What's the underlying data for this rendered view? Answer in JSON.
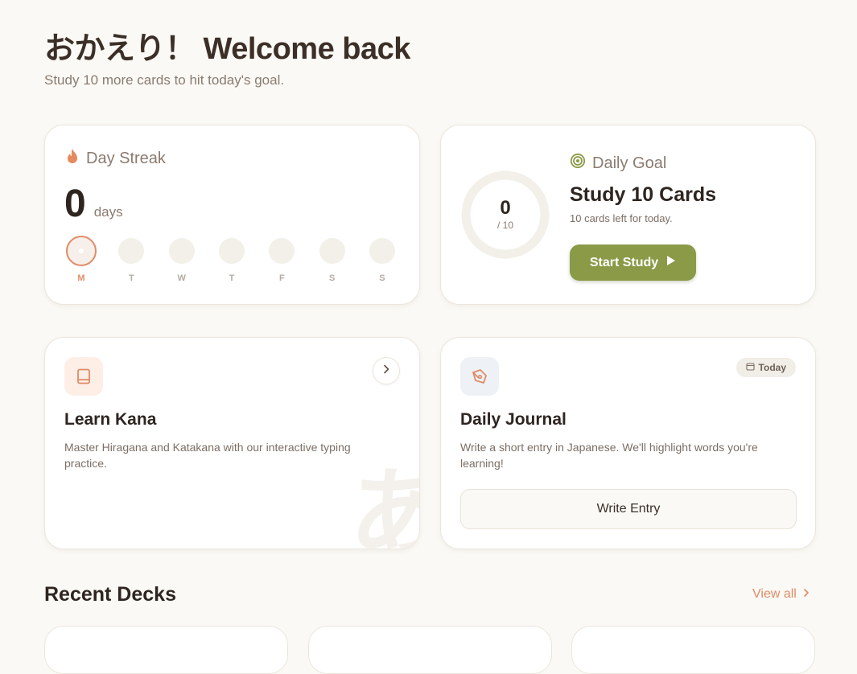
{
  "header": {
    "title": "おかえり！ Welcome back",
    "subtitle": "Study 10 more cards to hit today's goal."
  },
  "streak": {
    "label": "Day Streak",
    "count": "0",
    "unit": "days",
    "days": [
      "M",
      "T",
      "W",
      "T",
      "F",
      "S",
      "S"
    ],
    "active_index": 0,
    "icon": "flame-icon"
  },
  "goal": {
    "label": "Daily Goal",
    "progress_value": "0",
    "progress_total": "/ 10",
    "progress_fraction": 0,
    "title": "Study 10 Cards",
    "subtitle": "10 cards left for today.",
    "button_label": "Start Study",
    "icon": "target-icon"
  },
  "kana": {
    "title": "Learn Kana",
    "description": "Master Hiragana and Katakana with our interactive typing practice.",
    "watermark": "あ",
    "icon": "book-icon"
  },
  "journal": {
    "title": "Daily Journal",
    "description": "Write a short entry in Japanese. We'll highlight words you're learning!",
    "badge": "Today",
    "button_label": "Write Entry",
    "icon": "pen-icon"
  },
  "recent": {
    "title": "Recent Decks",
    "view_all": "View all"
  },
  "colors": {
    "accent": "#df8c67",
    "primary_button": "#8a9a47",
    "background": "#fbf9f5"
  }
}
